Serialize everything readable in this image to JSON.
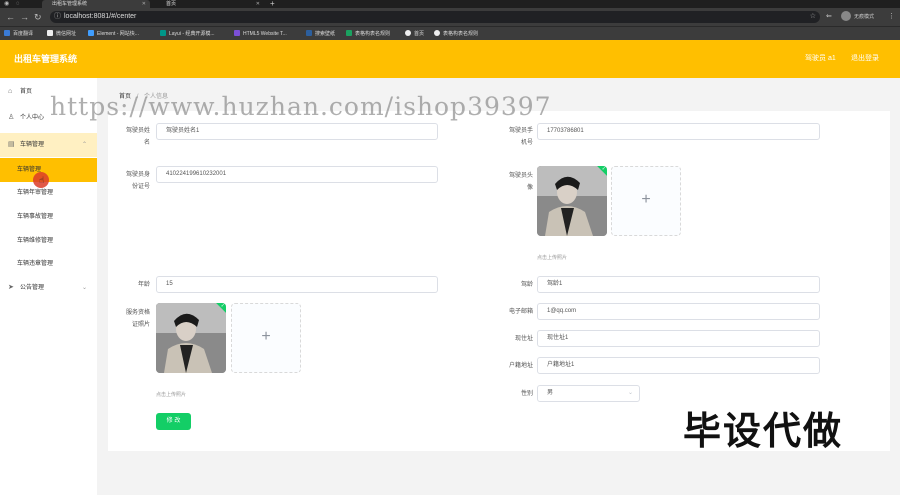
{
  "browser": {
    "tabs": [
      {
        "label": "出租车管理系统",
        "active": true
      },
      {
        "label": "首页",
        "active": false
      }
    ],
    "url": "localhost:8081/#/center",
    "profile_label": "无痕模式",
    "bookmarks": [
      {
        "label": "百度翻译",
        "color": "#3a7bd5"
      },
      {
        "label": "微信网址",
        "color": "#333333"
      },
      {
        "label": "Element - 网站快...",
        "color": "#409eff"
      },
      {
        "label": "Layui - 经典开源模...",
        "color": "#009688"
      },
      {
        "label": "HTML5 Website T...",
        "color": "#7b4fd6"
      },
      {
        "label": "搜索壁纸",
        "color": "#2c5f9e"
      },
      {
        "label": "表格构表名规则",
        "color": "#1aa260"
      },
      {
        "label": "首页",
        "color": "#eeeeee"
      },
      {
        "label": "表格构表名规则",
        "color": "#eeeeee"
      }
    ]
  },
  "header": {
    "title": "出租车管理系统",
    "user": "驾驶员 a1",
    "logout": "退出登录",
    "color": "#ffbf00"
  },
  "sidebar": {
    "home": "首页",
    "profile": "个人中心",
    "vehicle_group": "车辆管理",
    "vehicle_items": [
      "车辆管理",
      "车辆年审管理",
      "车辆事故管理",
      "车辆维修管理",
      "车辆违章管理"
    ],
    "notice_group": "公告管理"
  },
  "breadcrumb": {
    "home": "首页",
    "separator": "/",
    "current": "个人信息"
  },
  "form": {
    "driver_name_label_a": "驾驶员姓",
    "driver_name_label_b": "名",
    "driver_name": "驾驶员姓名1",
    "driver_phone_label_a": "驾驶员手",
    "driver_phone_label_b": "机号",
    "driver_phone": "17703786801",
    "id_card_label_a": "驾驶员身",
    "id_card_label_b": "份证号",
    "id_card": "410224199610232001",
    "avatar_label_a": "驾驶员头",
    "avatar_label_b": "像",
    "upload_hint": "点击上传照片",
    "age_label": "年龄",
    "age": "15",
    "driving_years_label": "驾龄",
    "driving_years": "驾龄1",
    "service_cert_label_a": "服务资格",
    "service_cert_label_b": "证照片",
    "email_label": "电子邮箱",
    "email": "1@qq.com",
    "address_label": "现住址",
    "address": "现住址1",
    "household_label": "户籍地址",
    "household": "户籍地址1",
    "gender_label": "性别",
    "gender": "男",
    "submit": "修 改",
    "submit_color": "#13ce66"
  },
  "overlays": {
    "watermark": "https://www.huzhan.com/ishop39397",
    "promo": "毕设代做"
  }
}
